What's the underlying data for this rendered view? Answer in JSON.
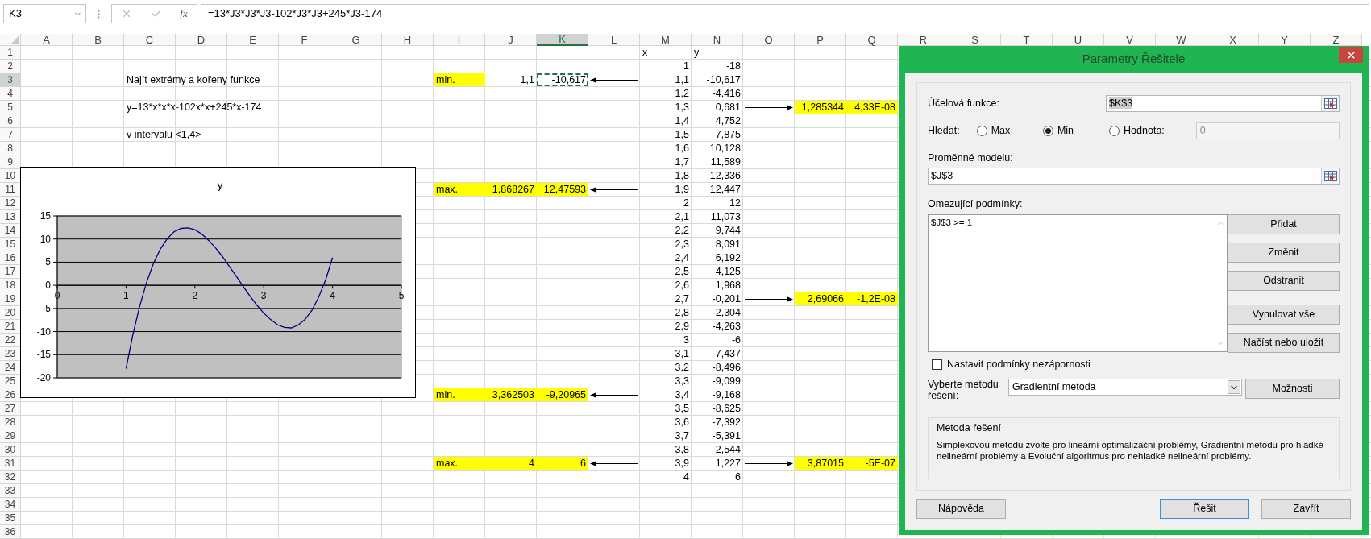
{
  "formula_bar": {
    "name_box": "K3",
    "function_label": "fx",
    "formula": "=13*J3*J3*J3-102*J3*J3+245*J3-174"
  },
  "columns": [
    {
      "label": "A",
      "selected": false
    },
    {
      "label": "B",
      "selected": false
    },
    {
      "label": "C",
      "selected": false
    },
    {
      "label": "D",
      "selected": false
    },
    {
      "label": "E",
      "selected": false
    },
    {
      "label": "F",
      "selected": false
    },
    {
      "label": "G",
      "selected": false
    },
    {
      "label": "H",
      "selected": false
    },
    {
      "label": "I",
      "selected": false
    },
    {
      "label": "J",
      "selected": false
    },
    {
      "label": "K",
      "selected": true
    },
    {
      "label": "L",
      "selected": false
    },
    {
      "label": "M",
      "selected": false
    },
    {
      "label": "N",
      "selected": false
    },
    {
      "label": "O",
      "selected": false
    },
    {
      "label": "P",
      "selected": false
    },
    {
      "label": "Q",
      "selected": false
    },
    {
      "label": "R",
      "selected": false
    },
    {
      "label": "S",
      "selected": false
    },
    {
      "label": "T",
      "selected": false
    },
    {
      "label": "U",
      "selected": false
    },
    {
      "label": "V",
      "selected": false
    },
    {
      "label": "W",
      "selected": false
    },
    {
      "label": "X",
      "selected": false
    },
    {
      "label": "Y",
      "selected": false
    },
    {
      "label": "Z",
      "selected": false
    }
  ],
  "sheet_rows": [
    {
      "number": "1",
      "selected": false,
      "cells": {
        "M": {
          "text": "x",
          "kind": "text",
          "highlight": false,
          "selected": false
        },
        "N": {
          "text": "y",
          "kind": "text",
          "highlight": false,
          "selected": false
        }
      }
    },
    {
      "number": "2",
      "selected": false,
      "cells": {
        "M": {
          "text": "1",
          "kind": "number",
          "highlight": false,
          "selected": false
        },
        "N": {
          "text": "-18",
          "kind": "number",
          "highlight": false,
          "selected": false
        }
      }
    },
    {
      "number": "3",
      "selected": true,
      "cells": {
        "C": {
          "text": "Najít extrémy a kořeny funkce",
          "kind": "text",
          "highlight": false,
          "selected": false
        },
        "I": {
          "text": "min.",
          "kind": "text",
          "highlight": true,
          "selected": false
        },
        "J": {
          "text": "1,1",
          "kind": "number",
          "highlight": false,
          "selected": false
        },
        "K": {
          "text": "-10,617",
          "kind": "number",
          "highlight": false,
          "selected": true
        },
        "M": {
          "text": "1,1",
          "kind": "number",
          "highlight": false,
          "selected": false
        },
        "N": {
          "text": "-10,617",
          "kind": "number",
          "highlight": false,
          "selected": false
        }
      },
      "arrows": [
        {
          "kind": "left"
        }
      ]
    },
    {
      "number": "4",
      "selected": false,
      "cells": {
        "M": {
          "text": "1,2",
          "kind": "number",
          "highlight": false,
          "selected": false
        },
        "N": {
          "text": "-4,416",
          "kind": "number",
          "highlight": false,
          "selected": false
        }
      }
    },
    {
      "number": "5",
      "selected": false,
      "cells": {
        "C": {
          "text": "y=13*x*x*x-102x*x+245*x-174",
          "kind": "text",
          "highlight": false,
          "selected": false
        },
        "M": {
          "text": "1,3",
          "kind": "number",
          "highlight": false,
          "selected": false
        },
        "N": {
          "text": "0,681",
          "kind": "number",
          "highlight": false,
          "selected": false
        },
        "P": {
          "text": "1,285344",
          "kind": "number",
          "highlight": true,
          "selected": false
        },
        "Q": {
          "text": "4,33E-08",
          "kind": "number",
          "highlight": true,
          "selected": false
        }
      },
      "arrows": [
        {
          "kind": "right"
        }
      ]
    },
    {
      "number": "6",
      "selected": false,
      "cells": {
        "M": {
          "text": "1,4",
          "kind": "number",
          "highlight": false,
          "selected": false
        },
        "N": {
          "text": "4,752",
          "kind": "number",
          "highlight": false,
          "selected": false
        }
      }
    },
    {
      "number": "7",
      "selected": false,
      "cells": {
        "C": {
          "text": "v intervalu <1,4>",
          "kind": "text",
          "highlight": false,
          "selected": false
        },
        "M": {
          "text": "1,5",
          "kind": "number",
          "highlight": false,
          "selected": false
        },
        "N": {
          "text": "7,875",
          "kind": "number",
          "highlight": false,
          "selected": false
        }
      }
    },
    {
      "number": "8",
      "selected": false,
      "cells": {
        "M": {
          "text": "1,6",
          "kind": "number",
          "highlight": false,
          "selected": false
        },
        "N": {
          "text": "10,128",
          "kind": "number",
          "highlight": false,
          "selected": false
        }
      }
    },
    {
      "number": "9",
      "selected": false,
      "cells": {
        "M": {
          "text": "1,7",
          "kind": "number",
          "highlight": false,
          "selected": false
        },
        "N": {
          "text": "11,589",
          "kind": "number",
          "highlight": false,
          "selected": false
        }
      }
    },
    {
      "number": "10",
      "selected": false,
      "cells": {
        "M": {
          "text": "1,8",
          "kind": "number",
          "highlight": false,
          "selected": false
        },
        "N": {
          "text": "12,336",
          "kind": "number",
          "highlight": false,
          "selected": false
        }
      }
    },
    {
      "number": "11",
      "selected": false,
      "cells": {
        "I": {
          "text": "max.",
          "kind": "text",
          "highlight": true,
          "selected": false
        },
        "J": {
          "text": "1,868267",
          "kind": "number",
          "highlight": true,
          "selected": false
        },
        "K": {
          "text": "12,47593",
          "kind": "number",
          "highlight": true,
          "selected": false
        },
        "M": {
          "text": "1,9",
          "kind": "number",
          "highlight": false,
          "selected": false
        },
        "N": {
          "text": "12,447",
          "kind": "number",
          "highlight": false,
          "selected": false
        }
      },
      "arrows": [
        {
          "kind": "left"
        }
      ]
    },
    {
      "number": "12",
      "selected": false,
      "cells": {
        "M": {
          "text": "2",
          "kind": "number",
          "highlight": false,
          "selected": false
        },
        "N": {
          "text": "12",
          "kind": "number",
          "highlight": false,
          "selected": false
        }
      }
    },
    {
      "number": "13",
      "selected": false,
      "cells": {
        "M": {
          "text": "2,1",
          "kind": "number",
          "highlight": false,
          "selected": false
        },
        "N": {
          "text": "11,073",
          "kind": "number",
          "highlight": false,
          "selected": false
        }
      }
    },
    {
      "number": "14",
      "selected": false,
      "cells": {
        "M": {
          "text": "2,2",
          "kind": "number",
          "highlight": false,
          "selected": false
        },
        "N": {
          "text": "9,744",
          "kind": "number",
          "highlight": false,
          "selected": false
        }
      }
    },
    {
      "number": "15",
      "selected": false,
      "cells": {
        "M": {
          "text": "2,3",
          "kind": "number",
          "highlight": false,
          "selected": false
        },
        "N": {
          "text": "8,091",
          "kind": "number",
          "highlight": false,
          "selected": false
        }
      }
    },
    {
      "number": "16",
      "selected": false,
      "cells": {
        "M": {
          "text": "2,4",
          "kind": "number",
          "highlight": false,
          "selected": false
        },
        "N": {
          "text": "6,192",
          "kind": "number",
          "highlight": false,
          "selected": false
        }
      }
    },
    {
      "number": "17",
      "selected": false,
      "cells": {
        "M": {
          "text": "2,5",
          "kind": "number",
          "highlight": false,
          "selected": false
        },
        "N": {
          "text": "4,125",
          "kind": "number",
          "highlight": false,
          "selected": false
        }
      }
    },
    {
      "number": "18",
      "selected": false,
      "cells": {
        "M": {
          "text": "2,6",
          "kind": "number",
          "highlight": false,
          "selected": false
        },
        "N": {
          "text": "1,968",
          "kind": "number",
          "highlight": false,
          "selected": false
        }
      }
    },
    {
      "number": "19",
      "selected": false,
      "cells": {
        "M": {
          "text": "2,7",
          "kind": "number",
          "highlight": false,
          "selected": false
        },
        "N": {
          "text": "-0,201",
          "kind": "number",
          "highlight": false,
          "selected": false
        },
        "P": {
          "text": "2,69066",
          "kind": "number",
          "highlight": true,
          "selected": false
        },
        "Q": {
          "text": "-1,2E-08",
          "kind": "number",
          "highlight": true,
          "selected": false
        }
      },
      "arrows": [
        {
          "kind": "right"
        }
      ]
    },
    {
      "number": "20",
      "selected": false,
      "cells": {
        "M": {
          "text": "2,8",
          "kind": "number",
          "highlight": false,
          "selected": false
        },
        "N": {
          "text": "-2,304",
          "kind": "number",
          "highlight": false,
          "selected": false
        }
      }
    },
    {
      "number": "21",
      "selected": false,
      "cells": {
        "M": {
          "text": "2,9",
          "kind": "number",
          "highlight": false,
          "selected": false
        },
        "N": {
          "text": "-4,263",
          "kind": "number",
          "highlight": false,
          "selected": false
        }
      }
    },
    {
      "number": "22",
      "selected": false,
      "cells": {
        "M": {
          "text": "3",
          "kind": "number",
          "highlight": false,
          "selected": false
        },
        "N": {
          "text": "-6",
          "kind": "number",
          "highlight": false,
          "selected": false
        }
      }
    },
    {
      "number": "23",
      "selected": false,
      "cells": {
        "M": {
          "text": "3,1",
          "kind": "number",
          "highlight": false,
          "selected": false
        },
        "N": {
          "text": "-7,437",
          "kind": "number",
          "highlight": false,
          "selected": false
        }
      }
    },
    {
      "number": "24",
      "selected": false,
      "cells": {
        "M": {
          "text": "3,2",
          "kind": "number",
          "highlight": false,
          "selected": false
        },
        "N": {
          "text": "-8,496",
          "kind": "number",
          "highlight": false,
          "selected": false
        }
      }
    },
    {
      "number": "25",
      "selected": false,
      "cells": {
        "M": {
          "text": "3,3",
          "kind": "number",
          "highlight": false,
          "selected": false
        },
        "N": {
          "text": "-9,099",
          "kind": "number",
          "highlight": false,
          "selected": false
        }
      }
    },
    {
      "number": "26",
      "selected": false,
      "cells": {
        "I": {
          "text": "min.",
          "kind": "text",
          "highlight": true,
          "selected": false
        },
        "J": {
          "text": "3,362503",
          "kind": "number",
          "highlight": true,
          "selected": false
        },
        "K": {
          "text": "-9,20965",
          "kind": "number",
          "highlight": true,
          "selected": false
        },
        "M": {
          "text": "3,4",
          "kind": "number",
          "highlight": false,
          "selected": false
        },
        "N": {
          "text": "-9,168",
          "kind": "number",
          "highlight": false,
          "selected": false
        }
      },
      "arrows": [
        {
          "kind": "left"
        }
      ]
    },
    {
      "number": "27",
      "selected": false,
      "cells": {
        "M": {
          "text": "3,5",
          "kind": "number",
          "highlight": false,
          "selected": false
        },
        "N": {
          "text": "-8,625",
          "kind": "number",
          "highlight": false,
          "selected": false
        }
      }
    },
    {
      "number": "28",
      "selected": false,
      "cells": {
        "M": {
          "text": "3,6",
          "kind": "number",
          "highlight": false,
          "selected": false
        },
        "N": {
          "text": "-7,392",
          "kind": "number",
          "highlight": false,
          "selected": false
        }
      }
    },
    {
      "number": "29",
      "selected": false,
      "cells": {
        "M": {
          "text": "3,7",
          "kind": "number",
          "highlight": false,
          "selected": false
        },
        "N": {
          "text": "-5,391",
          "kind": "number",
          "highlight": false,
          "selected": false
        }
      }
    },
    {
      "number": "30",
      "selected": false,
      "cells": {
        "M": {
          "text": "3,8",
          "kind": "number",
          "highlight": false,
          "selected": false
        },
        "N": {
          "text": "-2,544",
          "kind": "number",
          "highlight": false,
          "selected": false
        }
      }
    },
    {
      "number": "31",
      "selected": false,
      "cells": {
        "I": {
          "text": "max.",
          "kind": "text",
          "highlight": true,
          "selected": false
        },
        "J": {
          "text": "4",
          "kind": "number",
          "highlight": true,
          "selected": false
        },
        "K": {
          "text": "6",
          "kind": "number",
          "highlight": true,
          "selected": false
        },
        "M": {
          "text": "3,9",
          "kind": "number",
          "highlight": false,
          "selected": false
        },
        "N": {
          "text": "1,227",
          "kind": "number",
          "highlight": false,
          "selected": false
        },
        "P": {
          "text": "3,87015",
          "kind": "number",
          "highlight": true,
          "selected": false
        },
        "Q": {
          "text": "-5E-07",
          "kind": "number",
          "highlight": true,
          "selected": false
        }
      },
      "arrows": [
        {
          "kind": "left"
        },
        {
          "kind": "right"
        }
      ]
    },
    {
      "number": "32",
      "selected": false,
      "cells": {
        "M": {
          "text": "4",
          "kind": "number",
          "highlight": false,
          "selected": false
        },
        "N": {
          "text": "6",
          "kind": "number",
          "highlight": false,
          "selected": false
        }
      }
    },
    {
      "number": "33",
      "selected": false
    },
    {
      "number": "34",
      "selected": false
    },
    {
      "number": "35",
      "selected": false
    },
    {
      "number": "36",
      "selected": false
    }
  ],
  "chart": {
    "chart_data": {
      "type": "line",
      "title": "y",
      "grid": true,
      "x": [
        1,
        1.1,
        1.2,
        1.3,
        1.4,
        1.5,
        1.6,
        1.7,
        1.8,
        1.9,
        2,
        2.1,
        2.2,
        2.3,
        2.4,
        2.5,
        2.6,
        2.7,
        2.8,
        2.9,
        3,
        3.1,
        3.2,
        3.3,
        3.4,
        3.5,
        3.6,
        3.7,
        3.8,
        3.9,
        4
      ],
      "series": [
        {
          "color": "#000080",
          "values": [
            -18,
            -10.6,
            -4.4,
            0.7,
            4.8,
            7.9,
            10.1,
            11.6,
            12.3,
            12.4,
            12,
            11.1,
            9.7,
            8.1,
            6.2,
            4.1,
            2,
            -0.2,
            -2.3,
            -4.3,
            -6,
            -7.4,
            -8.5,
            -9.1,
            -9.2,
            -8.6,
            -7.4,
            -5.4,
            -2.5,
            1.2,
            6
          ]
        }
      ],
      "xlim": [
        0,
        5
      ],
      "ylim": [
        -20,
        15
      ],
      "xticks": [
        {
          "value": 0,
          "label": "0"
        },
        {
          "value": 1,
          "label": "1"
        },
        {
          "value": 2,
          "label": "2"
        },
        {
          "value": 3,
          "label": "3"
        },
        {
          "value": 4,
          "label": "4"
        },
        {
          "value": 5,
          "label": "5"
        }
      ],
      "yticks": [
        {
          "value": -20,
          "label": "-20"
        },
        {
          "value": -15,
          "label": "-15"
        },
        {
          "value": -10,
          "label": "-10"
        },
        {
          "value": -5,
          "label": "-5"
        },
        {
          "value": 0,
          "label": "0"
        },
        {
          "value": 5,
          "label": "5"
        },
        {
          "value": 10,
          "label": "10"
        },
        {
          "value": 15,
          "label": "15"
        }
      ]
    }
  },
  "solver_dialog": {
    "title": "Parametry Řešitele",
    "objective": {
      "label": "Účelová funkce:",
      "value": "$K$3"
    },
    "goal": {
      "label": "Hledat:",
      "options": [
        {
          "label": "Max",
          "selected": false
        },
        {
          "label": "Min",
          "selected": true
        },
        {
          "label": "Hodnota:",
          "selected": false
        }
      ],
      "value_field": {
        "value": "0",
        "disabled": true
      }
    },
    "variables": {
      "label": "Proměnné modelu:",
      "value": "$J$3"
    },
    "constraints": {
      "label": "Omezující podmínky:",
      "items": [
        "$J$3 >= 1"
      ]
    },
    "constraint_buttons": [
      "Přidat",
      "Změnit",
      "Odstranit",
      "Vynulovat vše",
      "Načíst nebo uložit"
    ],
    "nonnegative": {
      "label": "Nastavit podmínky nezápornosti",
      "checked": false
    },
    "method": {
      "label": "Vyberte metodu řešení:",
      "value": "Gradientní metoda",
      "options_button": "Možnosti"
    },
    "method_info": {
      "title": "Metoda řešení",
      "text": "Simplexovou metodu zvolte pro lineární optimalizační problémy, Gradientní metodu pro hladké nelineární problémy a Evoluční algoritmus pro nehladké nelineární problémy."
    },
    "footer_buttons": [
      {
        "label": "Nápověda",
        "focused": false
      },
      {
        "label": "Řešit",
        "focused": true
      },
      {
        "label": "Zavřít",
        "focused": false
      }
    ]
  }
}
